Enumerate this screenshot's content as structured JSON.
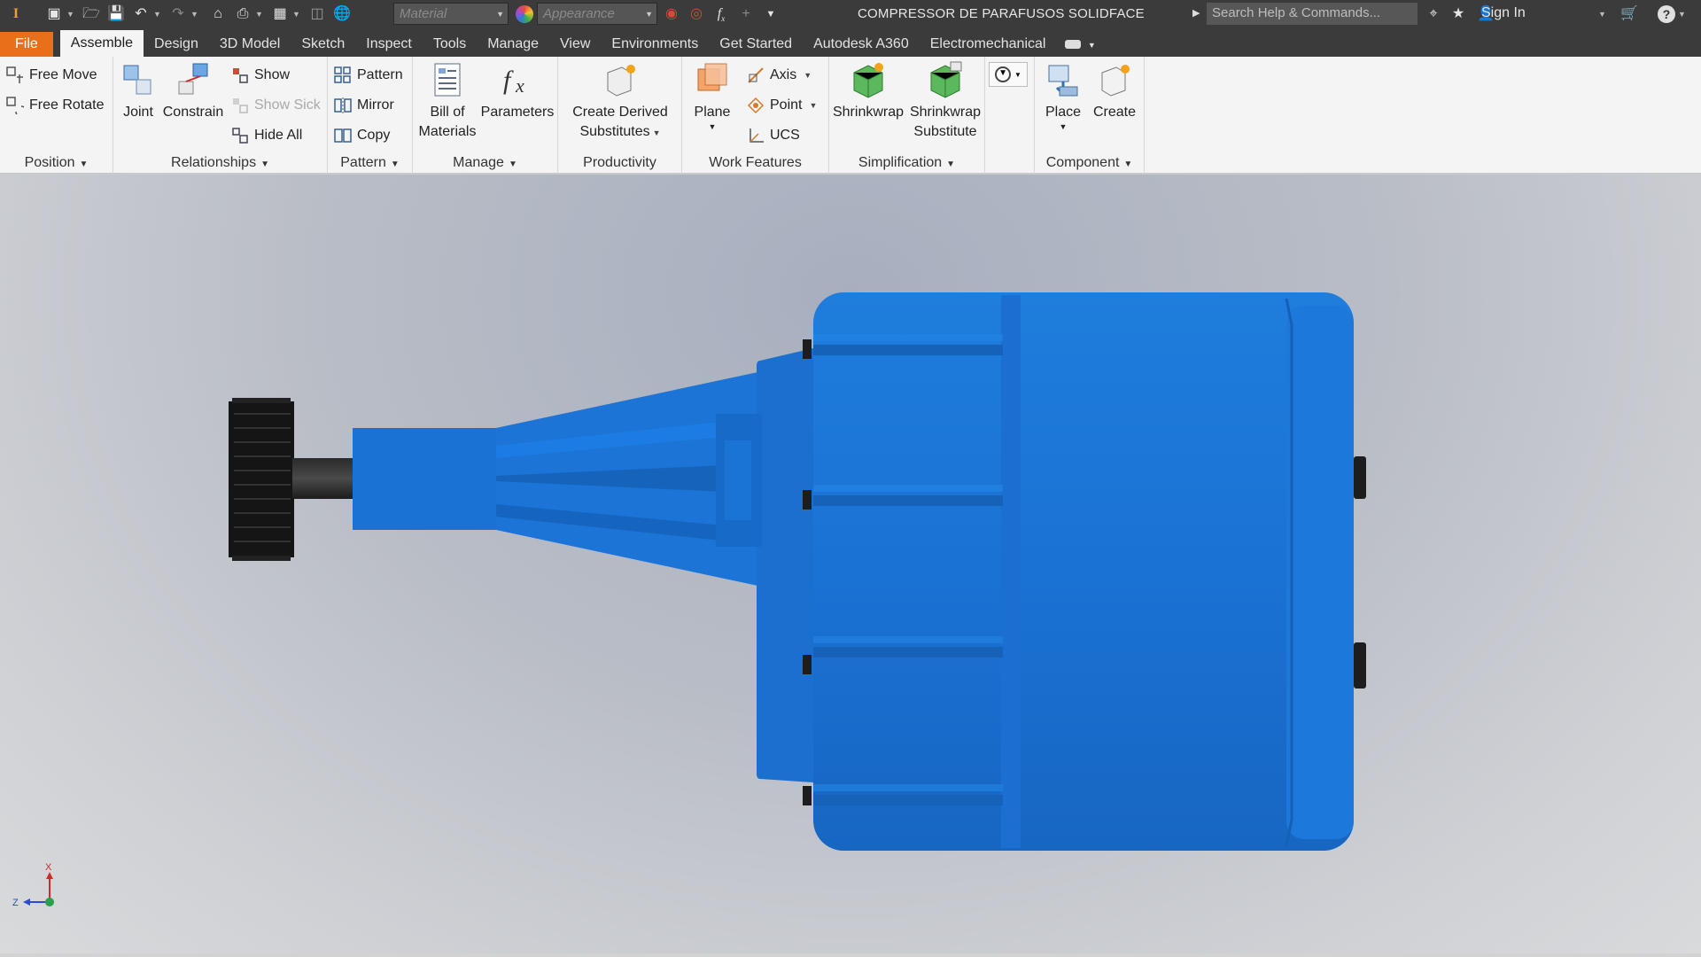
{
  "titlebar": {
    "document_title": "COMPRESSOR DE PARAFUSOS SOLIDFACE",
    "material_placeholder": "Material",
    "appearance_placeholder": "Appearance",
    "search_placeholder": "Search Help & Commands...",
    "sign_in": "Sign In"
  },
  "tabs": [
    {
      "label": "File"
    },
    {
      "label": "Assemble"
    },
    {
      "label": "Design"
    },
    {
      "label": "3D Model"
    },
    {
      "label": "Sketch"
    },
    {
      "label": "Inspect"
    },
    {
      "label": "Tools"
    },
    {
      "label": "Manage"
    },
    {
      "label": "View"
    },
    {
      "label": "Environments"
    },
    {
      "label": "Get Started"
    },
    {
      "label": "Autodesk A360"
    },
    {
      "label": "Electromechanical"
    }
  ],
  "active_tab": "Assemble",
  "ribbon": {
    "position": {
      "label": "Position",
      "free_move": "Free Move",
      "free_rotate": "Free Rotate"
    },
    "relationships": {
      "label": "Relationships",
      "joint": "Joint",
      "constrain": "Constrain",
      "show": "Show",
      "show_sick": "Show Sick",
      "hide_all": "Hide All"
    },
    "pattern": {
      "label": "Pattern",
      "pattern": "Pattern",
      "mirror": "Mirror",
      "copy": "Copy"
    },
    "manage": {
      "label": "Manage",
      "bom_line1": "Bill of",
      "bom_line2": "Materials",
      "parameters": "Parameters"
    },
    "productivity": {
      "label": "Productivity",
      "cds_line1": "Create Derived",
      "cds_line2": "Substitutes"
    },
    "work_features": {
      "label": "Work Features",
      "plane": "Plane",
      "axis": "Axis",
      "point": "Point",
      "ucs": "UCS"
    },
    "simplification": {
      "label": "Simplification",
      "shrinkwrap": "Shrinkwrap",
      "shrinkwrap_sub_line1": "Shrinkwrap",
      "shrinkwrap_sub_line2": "Substitute"
    },
    "component": {
      "label": "Component",
      "place": "Place",
      "create": "Create"
    }
  },
  "viewport": {
    "triad_x": "X",
    "triad_z": "Z",
    "model_color": "#1a72d4",
    "background_top": "#a7afbf",
    "background_bottom": "#d9dadc"
  },
  "accent": {
    "file_tab": "#e8701a",
    "titlebar": "#3b3b3b"
  }
}
